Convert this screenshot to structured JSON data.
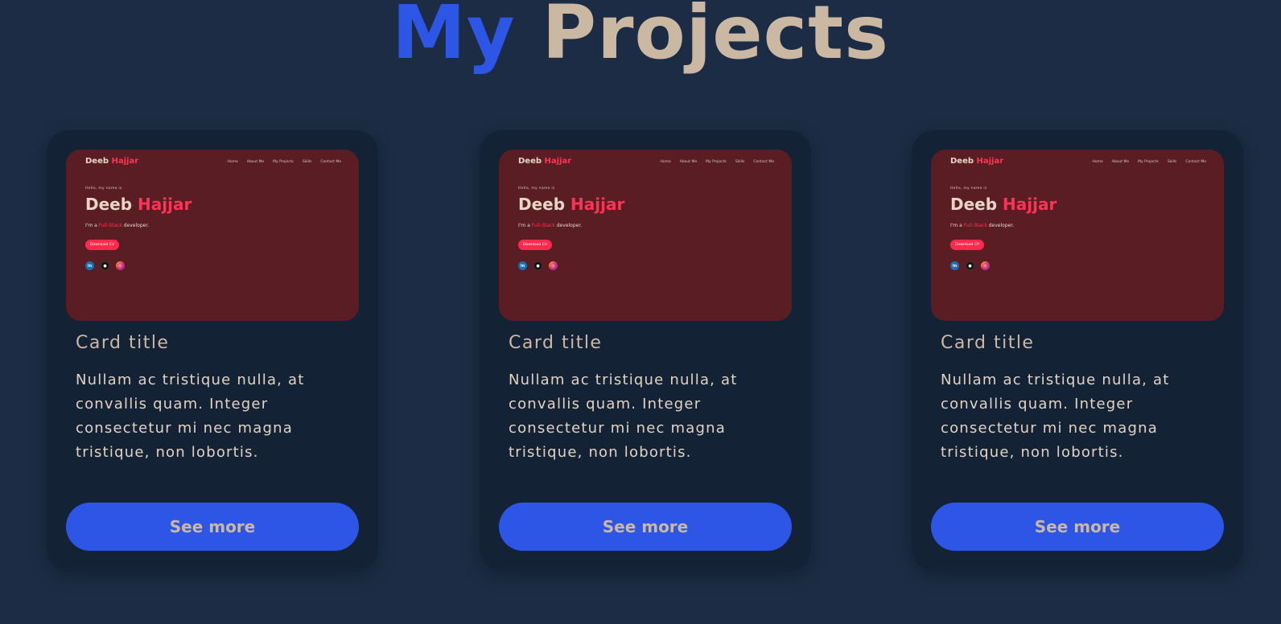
{
  "heading": {
    "word1": "My",
    "word2": "Projects"
  },
  "colors": {
    "background": "#1b2c44",
    "card": "#142235",
    "accent_blue": "#2d55e6",
    "beige": "#cbb8a2",
    "preview_bg": "#5a1d24",
    "preview_accent": "#ff3355"
  },
  "cards": [
    {
      "preview": {
        "logo_first": "Deeb",
        "logo_accent": "Hajjar",
        "nav": [
          "Home",
          "About Me",
          "My Projects",
          "Skills",
          "Contact Me"
        ],
        "hello": "Hello, my name is",
        "name_first": "Deeb",
        "name_accent": "Hajjar",
        "role_prefix": "I'm a",
        "role_accent": "Full-Stack",
        "role_suffix": "developer.",
        "cv_button": "Download CV",
        "social_icons": [
          "linkedin-icon",
          "github-icon",
          "instagram-icon"
        ]
      },
      "title": "Card title",
      "text": "Nullam ac tristique nulla, at convallis quam. Integer consectetur mi nec magna tristique, non lobortis.",
      "button": "See more"
    },
    {
      "preview": {
        "logo_first": "Deeb",
        "logo_accent": "Hajjar",
        "nav": [
          "Home",
          "About Me",
          "My Projects",
          "Skills",
          "Contact Me"
        ],
        "hello": "Hello, my name is",
        "name_first": "Deeb",
        "name_accent": "Hajjar",
        "role_prefix": "I'm a",
        "role_accent": "Full-Stack",
        "role_suffix": "developer.",
        "cv_button": "Download CV",
        "social_icons": [
          "linkedin-icon",
          "github-icon",
          "instagram-icon"
        ]
      },
      "title": "Card title",
      "text": "Nullam ac tristique nulla, at convallis quam. Integer consectetur mi nec magna tristique, non lobortis.",
      "button": "See more"
    },
    {
      "preview": {
        "logo_first": "Deeb",
        "logo_accent": "Hajjar",
        "nav": [
          "Home",
          "About Me",
          "My Projects",
          "Skills",
          "Contact Me"
        ],
        "hello": "Hello, my name is",
        "name_first": "Deeb",
        "name_accent": "Hajjar",
        "role_prefix": "I'm a",
        "role_accent": "Full-Stack",
        "role_suffix": "developer.",
        "cv_button": "Download CV",
        "social_icons": [
          "linkedin-icon",
          "github-icon",
          "instagram-icon"
        ]
      },
      "title": "Card title",
      "text": "Nullam ac tristique nulla, at convallis quam. Integer consectetur mi nec magna tristique, non lobortis.",
      "button": "See more"
    }
  ]
}
